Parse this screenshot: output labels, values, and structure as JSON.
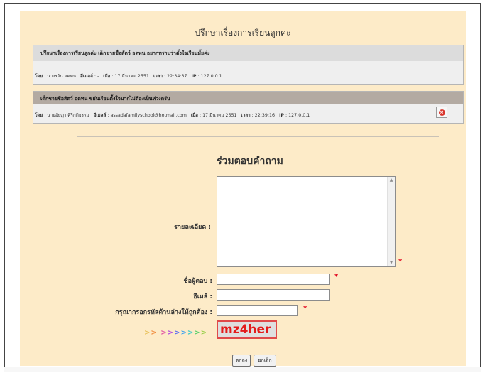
{
  "page_title": "ปรึกษาเรื่องการเรียนลูกค่ะ",
  "topic": {
    "heading": "ปรึกษาเรื่องการเรียนลูกค่ะ เด็กชายชื่อสัตว์ อดทน อยากทราบว่าตั้งใจเรียนมั้ยค่ะ",
    "by_label": "โดย",
    "by_value": ": นางรอัน อดทน",
    "email_label": "อีเมลล์",
    "email_value": ": -",
    "date_label": "เมื่อ",
    "date_value": ": 17 มีนาคม 2551",
    "time_label": "เวลา",
    "time_value": ": 22:34:37",
    "ip_label": "IP",
    "ip_value": ": 127.0.0.1"
  },
  "reply": {
    "heading": "เด็กชายชื่อสัตว์ อดทน ขยันเรียนตั้งใจมากไม่ต้องเป็นห่วงครับ",
    "by_label": "โดย",
    "by_value": ": นายอัษฎา ศิริกติธรรม",
    "email_label": "อีเมลล์",
    "email_value": ": assadafamilyschool@hotmail.com",
    "date_label": "เมื่อ",
    "date_value": ": 17 มีนาคม 2551",
    "time_label": "เวลา",
    "time_value": ": 22:39:16",
    "ip_label": "IP",
    "ip_value": ": 127.0.0.1"
  },
  "form": {
    "title": "ร่วมตอบคำถาม",
    "detail_label": "รายละเอียด :",
    "name_label": "ชื่อผู้ตอบ :",
    "email_label": "อีเมล์ :",
    "captcha_label": "กรุณากรอกรหัสด้านล่างให้ถูกต้อง :",
    "required_mark": "*",
    "detail_value": "",
    "name_value": "",
    "email_value": "",
    "captcha_value": "",
    "captcha_arrows": ">> >>>>>>>",
    "captcha_code": "mz4her",
    "submit_label": "ตกลง",
    "cancel_label": "ยกเลิก"
  },
  "colors": {
    "panel_bg": "#fdebc8",
    "required": "#e0001b",
    "captcha_text": "#e41b1b"
  }
}
